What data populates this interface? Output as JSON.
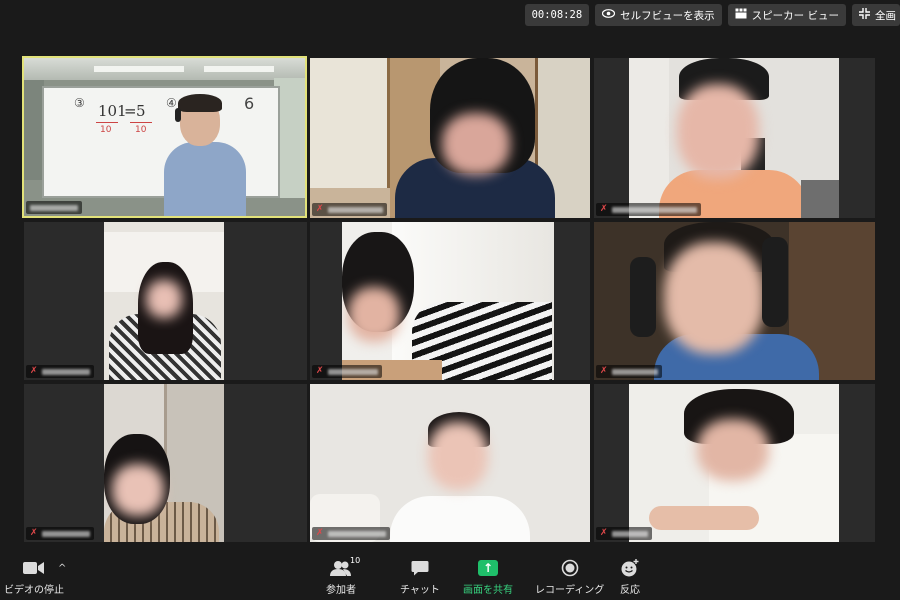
{
  "topbar": {
    "timer": "00:08:28",
    "self_view_label": "セルフビューを表示",
    "speaker_view_label": "スピーカー ビュー",
    "fullscreen_label": "全画"
  },
  "whiteboard": {
    "step1": "③",
    "fraction1": "10",
    "fraction2": "10",
    "step2": "④",
    "eq_left": "101",
    "eq_right": "5",
    "digit": "6"
  },
  "toolbar": {
    "video_label": "ビデオの停止",
    "participants_label": "参加者",
    "participants_count": "10",
    "chat_label": "チャット",
    "share_label": "画面を共有",
    "record_label": "レコーディング",
    "react_label": "反応"
  },
  "colors": {
    "active_border": "#e2e27a",
    "share_green": "#1fbf6a",
    "muted_red": "#e0484a",
    "background": "#1a1a1a"
  },
  "icons": [
    "eye-icon",
    "speaker-view-icon",
    "fullscreen-icon",
    "camera-icon",
    "chevron-up-icon",
    "participants-icon",
    "chat-icon",
    "share-icon",
    "record-icon",
    "react-icon",
    "mic-muted-icon"
  ]
}
